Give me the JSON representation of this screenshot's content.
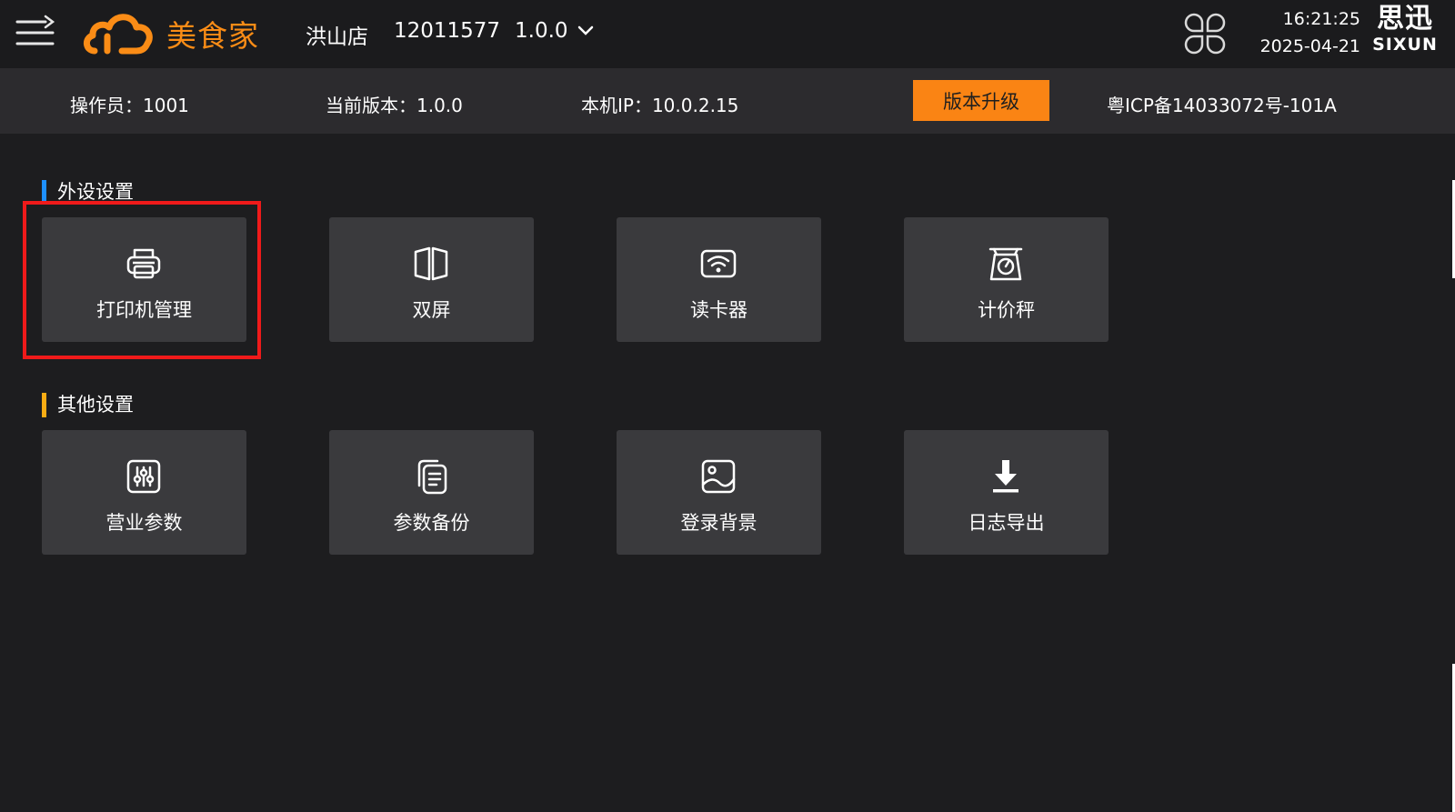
{
  "header": {
    "brand": "美食家",
    "store": "洪山店",
    "store_id": "12011577",
    "version": "1.0.0",
    "time": "16:21:25",
    "date": "2025-04-21",
    "vendor_cn": "思迅",
    "vendor_en": "SIXUN"
  },
  "info_bar": {
    "operator": "操作员：1001",
    "current_version": "当前版本：1.0.0",
    "local_ip": "本机IP：10.0.2.15",
    "upgrade_label": "版本升级",
    "icp": "粤ICP备14033072号-101A"
  },
  "sections": [
    {
      "title": "外设设置",
      "accent": "#1e90ff",
      "tiles": [
        {
          "label": "打印机管理",
          "icon": "printer-icon"
        },
        {
          "label": "双屏",
          "icon": "dual-screen-icon"
        },
        {
          "label": "读卡器",
          "icon": "card-reader-icon"
        },
        {
          "label": "计价秤",
          "icon": "scale-icon"
        }
      ]
    },
    {
      "title": "其他设置",
      "accent": "#faad14",
      "tiles": [
        {
          "label": "营业参数",
          "icon": "sliders-icon"
        },
        {
          "label": "参数备份",
          "icon": "backup-icon"
        },
        {
          "label": "登录背景",
          "icon": "image-icon"
        },
        {
          "label": "日志导出",
          "icon": "download-icon"
        }
      ]
    }
  ],
  "colors": {
    "accent_orange": "#fa8c16",
    "highlight_red": "#f01a1a",
    "tile_bg": "#3a3a3d",
    "page_bg": "#1d1d1f"
  }
}
